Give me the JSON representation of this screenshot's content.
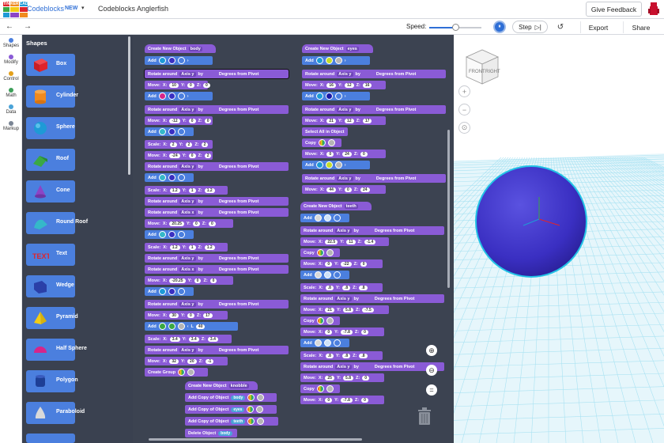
{
  "logo": {
    "letters": [
      "TIN",
      "KER",
      "CAD",
      "",
      "",
      "",
      "",
      "",
      ""
    ]
  },
  "header": {
    "app_name": "Codeblocks",
    "badge": "NEW",
    "doc_title": "Codeblocks Anglerfish",
    "feedback_label": "Give Feedback"
  },
  "toolbar": {
    "undo_icon": "undo-arrow",
    "redo_icon": "redo-arrow",
    "speed_label": "Speed:",
    "step_label": "Step",
    "export_label": "Export",
    "share_label": "Share"
  },
  "categories": [
    {
      "label": "Shapes",
      "color": "#4b7fde"
    },
    {
      "label": "Modify",
      "color": "#8a5bd6"
    },
    {
      "label": "Control",
      "color": "#e3a01b"
    },
    {
      "label": "Math",
      "color": "#3d9f5a"
    },
    {
      "label": "Data",
      "color": "#4aa3d8"
    },
    {
      "label": "Markup",
      "color": "#7a8594"
    }
  ],
  "palette": {
    "title": "Shapes",
    "items": [
      {
        "label": "Box",
        "color": "#e0242b"
      },
      {
        "label": "Cylinder",
        "color": "#f08a1e"
      },
      {
        "label": "Sphere",
        "color": "#1e9ad6"
      },
      {
        "label": "Roof",
        "color": "#3aa844"
      },
      {
        "label": "Cone",
        "color": "#8b45c6"
      },
      {
        "label": "Round Roof",
        "color": "#35b8c9"
      },
      {
        "label": "Text",
        "color": "#e0242b"
      },
      {
        "label": "Wedge",
        "color": "#2a3fa8"
      },
      {
        "label": "Pyramid",
        "color": "#f2cc16"
      },
      {
        "label": "Half Sphere",
        "color": "#d6258a"
      },
      {
        "label": "Polygon",
        "color": "#1e3f96"
      },
      {
        "label": "Paraboloid",
        "color": "#cfcfcf"
      }
    ]
  },
  "blocks": {
    "create_new_object": "Create New Object",
    "add": "Add",
    "rotate_around": "Rotate around",
    "axis_y": "Axis y",
    "axis_x": "Axis x",
    "by": "by",
    "degrees_from_pivot": "Degrees   from Pivot",
    "move": "Move:",
    "scale": "Scale:",
    "copy": "Copy",
    "select_all": "Select All in Object",
    "create_group": "Create Group",
    "add_copy": "Add Copy of Object",
    "delete_object": "Delete Object",
    "x": "X:",
    "y": "Y:",
    "z": "Z:",
    "body": "body",
    "eyes": "eyes",
    "teeth": "teeth",
    "knobble": "knobble"
  },
  "stack1": {
    "moves": [
      [
        "10",
        "0",
        "0"
      ],
      [
        "-12",
        "0",
        "0"
      ],
      [
        "-24",
        "0",
        "2"
      ],
      [
        "20.25",
        "0",
        "0"
      ],
      [
        "-20.25",
        "0",
        "0"
      ],
      [
        "30",
        "0",
        "17"
      ],
      [
        "32",
        "20",
        "-1"
      ]
    ],
    "scales": [
      [
        "2",
        "2",
        "2"
      ],
      [
        "1.2",
        "1",
        "1.2"
      ],
      [
        "1.2",
        "1",
        "1.2"
      ],
      [
        "3.4",
        "3.4",
        "3.4"
      ]
    ],
    "l_label": "L",
    "l_value": "40"
  },
  "stack2": {
    "moves": [
      [
        "16",
        "12",
        "16"
      ],
      [
        "21",
        "12",
        "17"
      ],
      [
        "0",
        "24",
        "0"
      ],
      [
        "44",
        "0",
        "24"
      ]
    ]
  },
  "stack3": {
    "moves": [
      [
        "22.5",
        "11",
        "-1.4"
      ],
      [
        "0",
        "-22",
        "0"
      ],
      [
        "21",
        "5.8",
        "-7.5"
      ],
      [
        "0",
        "-7.8",
        "0"
      ],
      [
        "25",
        "5.8",
        "0"
      ],
      [
        "0",
        "-7.8",
        "0"
      ]
    ],
    "scales": [
      [
        ".8",
        ".8",
        ".8"
      ],
      [
        ".8",
        ".8",
        ".8"
      ]
    ]
  },
  "viewcube": {
    "front": "FRONT",
    "right": "RIGHT"
  },
  "viewport": {
    "sphere_color": "#3a2fc2",
    "grid_color": "#a9e2f2"
  }
}
